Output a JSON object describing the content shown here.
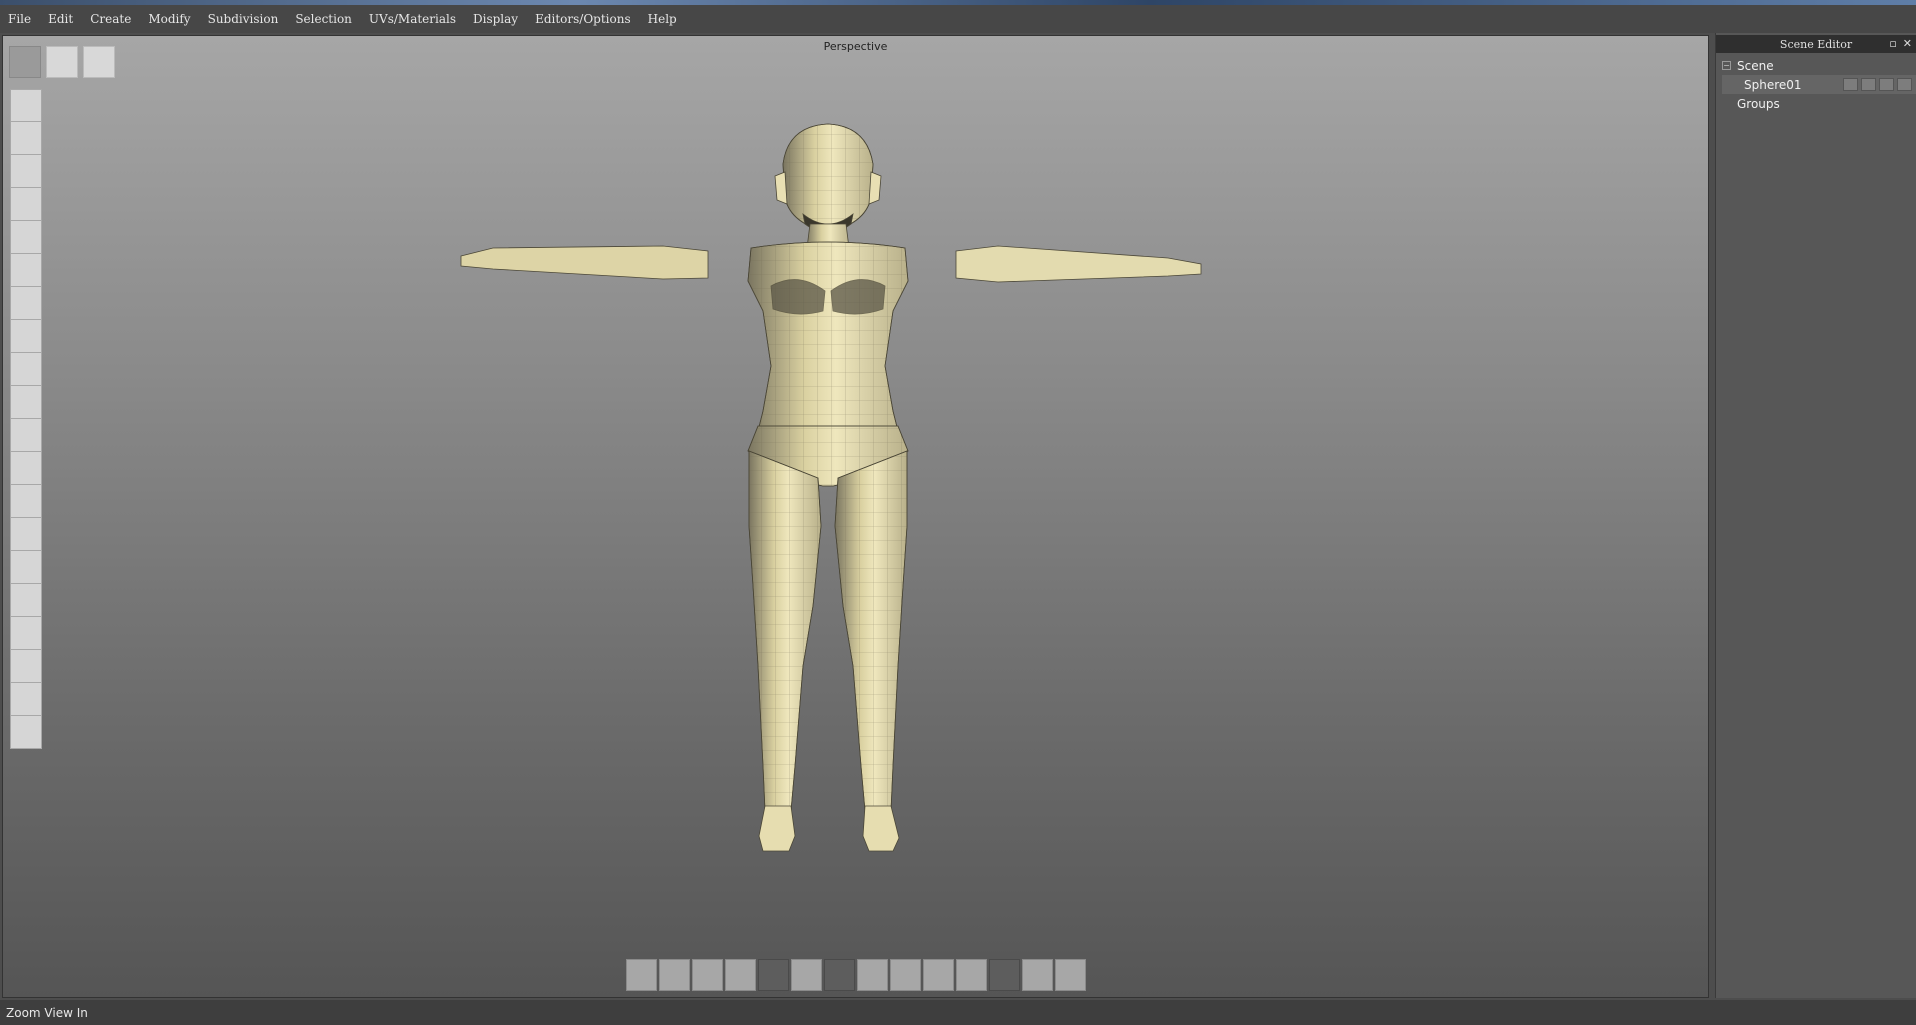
{
  "menu": [
    "File",
    "Edit",
    "Create",
    "Modify",
    "Subdivision",
    "Selection",
    "UVs/Materials",
    "Display",
    "Editors/Options",
    "Help"
  ],
  "viewport": {
    "title": "Perspective"
  },
  "scene_editor": {
    "title": "Scene Editor",
    "maximize_icon": "square-icon",
    "close_icon": "close-icon",
    "tree": {
      "root": "Scene",
      "child": "Sphere01",
      "groups": "Groups"
    }
  },
  "status": "Zoom View In",
  "colors": {
    "model_light": "#e8dfae",
    "model_dark": "#3a3a32",
    "viewport_top": "#a6a6a6"
  }
}
